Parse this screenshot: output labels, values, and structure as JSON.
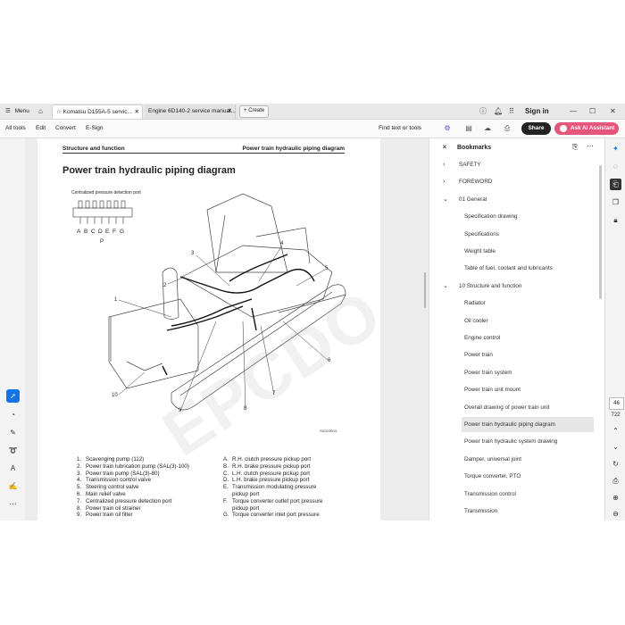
{
  "tabbar": {
    "menu_label": "Menu",
    "tabs": [
      {
        "label": "Komatsu D155A-5 servic...",
        "active": true
      },
      {
        "label": "Engine 6D140-2 service manual...",
        "active": false
      }
    ],
    "create_label": "Create",
    "sign_in": "Sign in"
  },
  "toolbar": {
    "menus": [
      "All tools",
      "Edit",
      "Convert",
      "E-Sign"
    ],
    "find_label": "Find text or tools",
    "share_label": "Share",
    "ai_label": "Ask AI Assistant"
  },
  "document": {
    "header_left": "Structure and function",
    "header_right": "Power train hydraulic piping diagram",
    "title": "Power train hydraulic piping diagram",
    "diagram_caption": "Centralized pressure detection port",
    "port_letters": [
      "A",
      "B",
      "C",
      "D",
      "E",
      "F",
      "G"
    ],
    "port_p": "P",
    "callouts": [
      "1",
      "2",
      "3",
      "4",
      "5",
      "6",
      "7",
      "8",
      "9",
      "10"
    ],
    "diagram_code": "SKD00015",
    "watermark": "EPCDO.COM",
    "legend_left": [
      {
        "k": "1.",
        "t": "Scavenging pump (112)"
      },
      {
        "k": "2.",
        "t": "Power train lubrication pump (SAL(3)-100)"
      },
      {
        "k": "3.",
        "t": "Power train pump (SAL(3)-80)"
      },
      {
        "k": "4.",
        "t": "Transmission control valve"
      },
      {
        "k": "5.",
        "t": "Steering control valve"
      },
      {
        "k": "6.",
        "t": "Main relief valve"
      },
      {
        "k": "7.",
        "t": "Centralized pressure detection port"
      },
      {
        "k": "8.",
        "t": "Power train oil strainer"
      },
      {
        "k": "9.",
        "t": "Power train oil filter"
      }
    ],
    "legend_right": [
      {
        "k": "A.",
        "t": "R.H. clutch pressure pickup port"
      },
      {
        "k": "B.",
        "t": "R.H. brake pressure pickup port"
      },
      {
        "k": "C.",
        "t": "L.H. clutch pressure pickup port"
      },
      {
        "k": "D.",
        "t": "L.H. brake pressure pickup port"
      },
      {
        "k": "E.",
        "t": "Transmission modulating pressure"
      },
      {
        "k": "",
        "t": "pickup port"
      },
      {
        "k": "F.",
        "t": "Torque converter outlet port pressure"
      },
      {
        "k": "",
        "t": "pickup port"
      },
      {
        "k": "G.",
        "t": "Torque converter inlet port pressure"
      }
    ]
  },
  "bookmarks": {
    "title": "Bookmarks",
    "items": [
      {
        "label": "SAFETY",
        "chevron": "›",
        "indent": 0
      },
      {
        "label": "FOREWORD",
        "chevron": "›",
        "indent": 0
      },
      {
        "label": "01 General",
        "chevron": "⌄",
        "indent": 0
      },
      {
        "label": "Specification drawing",
        "chevron": "",
        "indent": 1
      },
      {
        "label": "Specifications",
        "chevron": "",
        "indent": 1
      },
      {
        "label": "Weight table",
        "chevron": "",
        "indent": 1
      },
      {
        "label": "Table of fuel, coolant and lubricants",
        "chevron": "",
        "indent": 1
      },
      {
        "label": "10 Structure and function",
        "chevron": "⌄",
        "indent": 0
      },
      {
        "label": "Radiator",
        "chevron": "",
        "indent": 1
      },
      {
        "label": "Oil cooler",
        "chevron": "",
        "indent": 1
      },
      {
        "label": "Engine control",
        "chevron": "",
        "indent": 1
      },
      {
        "label": "Power train",
        "chevron": "",
        "indent": 1
      },
      {
        "label": "Power train system",
        "chevron": "",
        "indent": 1
      },
      {
        "label": "Power train unit mount",
        "chevron": "",
        "indent": 1
      },
      {
        "label": "Overall drawing of power train unit",
        "chevron": "",
        "indent": 1
      },
      {
        "label": "Power train hydraulic piping diagram",
        "chevron": "",
        "indent": 1,
        "selected": true
      },
      {
        "label": "Power train hydraulic system drawing",
        "chevron": "",
        "indent": 1
      },
      {
        "label": "Damper, universal joint",
        "chevron": "",
        "indent": 1
      },
      {
        "label": "Torque converter, PTO",
        "chevron": "",
        "indent": 1
      },
      {
        "label": "Transmission control",
        "chevron": "",
        "indent": 1
      },
      {
        "label": "Transmission",
        "chevron": "",
        "indent": 1
      }
    ]
  },
  "pager": {
    "current": "46",
    "total": "722"
  },
  "colors": {
    "accent": "#1473e6",
    "ai_button": "#e6557a",
    "share_button": "#222222"
  }
}
